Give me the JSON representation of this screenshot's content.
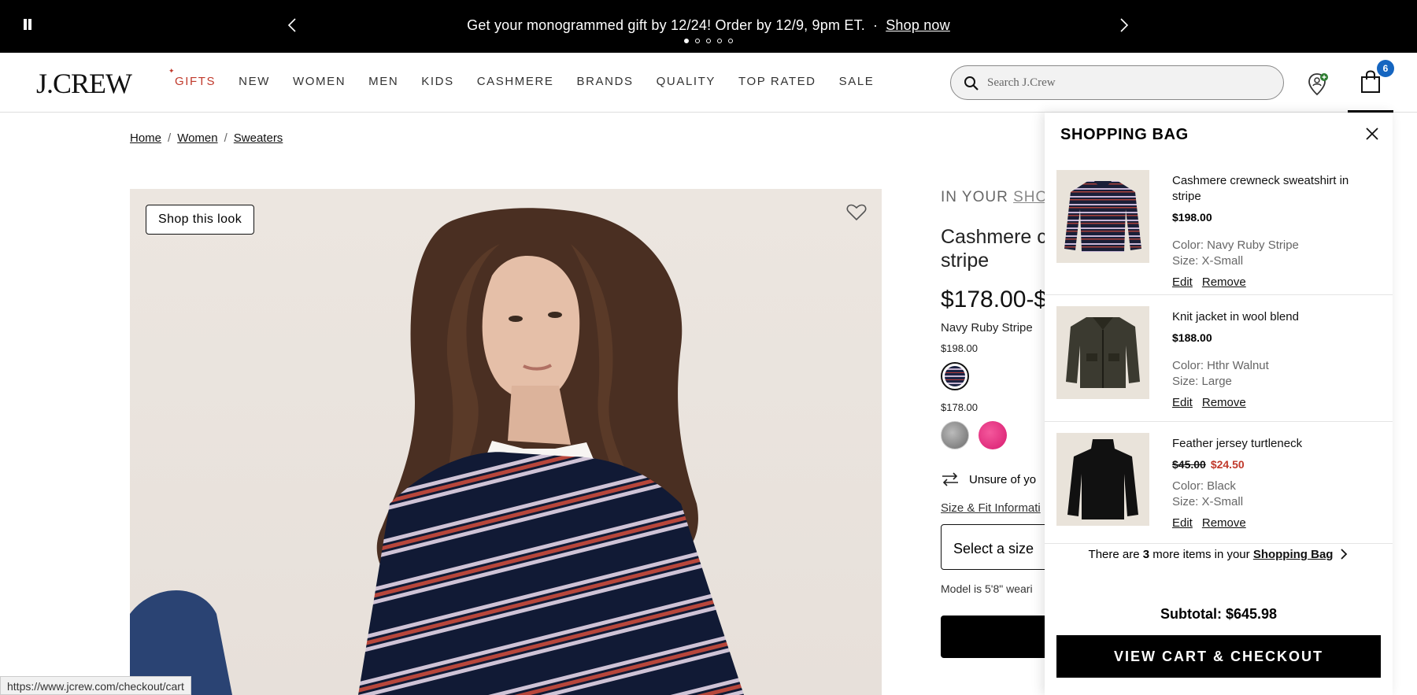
{
  "promo": {
    "message": "Get your monogrammed gift by 12/24! Order by 12/9, 9pm ET.",
    "separator": "·",
    "link": "Shop now"
  },
  "header": {
    "logo": "J.CREW",
    "nav": [
      "GIFTS",
      "NEW",
      "WOMEN",
      "MEN",
      "KIDS",
      "CASHMERE",
      "BRANDS",
      "QUALITY",
      "TOP RATED",
      "SALE"
    ],
    "search_placeholder": "Search J.Crew",
    "bag_count": "6"
  },
  "breadcrumb": [
    "Home",
    "Women",
    "Sweaters"
  ],
  "hero": {
    "shop_look": "Shop this look"
  },
  "product": {
    "in_bag_prefix": "IN YOUR",
    "in_bag_link": "SHOP",
    "name": "Cashmere c",
    "name_line2": "stripe",
    "price": "$178.00-$",
    "color_name": "Navy Ruby Stripe",
    "price_tier_1": "$198.00",
    "price_tier_2": "$178.00",
    "unsure": "Unsure of yo",
    "fit_link": "Size & Fit Informati",
    "size_select": "Select a size",
    "model_note": "Model is 5'8\" weari"
  },
  "status_url": "https://www.jcrew.com/checkout/cart",
  "bag": {
    "title": "SHOPPING BAG",
    "items": [
      {
        "name": "Cashmere crewneck sweatshirt in stripe",
        "price": "$198.00",
        "color": "Color: Navy Ruby Stripe",
        "size": "Size: X-Small",
        "edit": "Edit",
        "remove": "Remove"
      },
      {
        "name": "Knit jacket in wool blend",
        "price": "$188.00",
        "color": "Color: Hthr Walnut",
        "size": "Size: Large",
        "edit": "Edit",
        "remove": "Remove"
      },
      {
        "name": "Feather jersey turtleneck",
        "price_original": "$45.00",
        "price_sale": "$24.50",
        "color": "Color: Black",
        "size": "Size: X-Small",
        "edit": "Edit",
        "remove": "Remove"
      }
    ],
    "more_prefix": "There are",
    "more_count": "3",
    "more_middle": "more items in your",
    "more_link": "Shopping Bag",
    "subtotal": "Subtotal: $645.98",
    "checkout": "VIEW CART & CHECKOUT"
  }
}
